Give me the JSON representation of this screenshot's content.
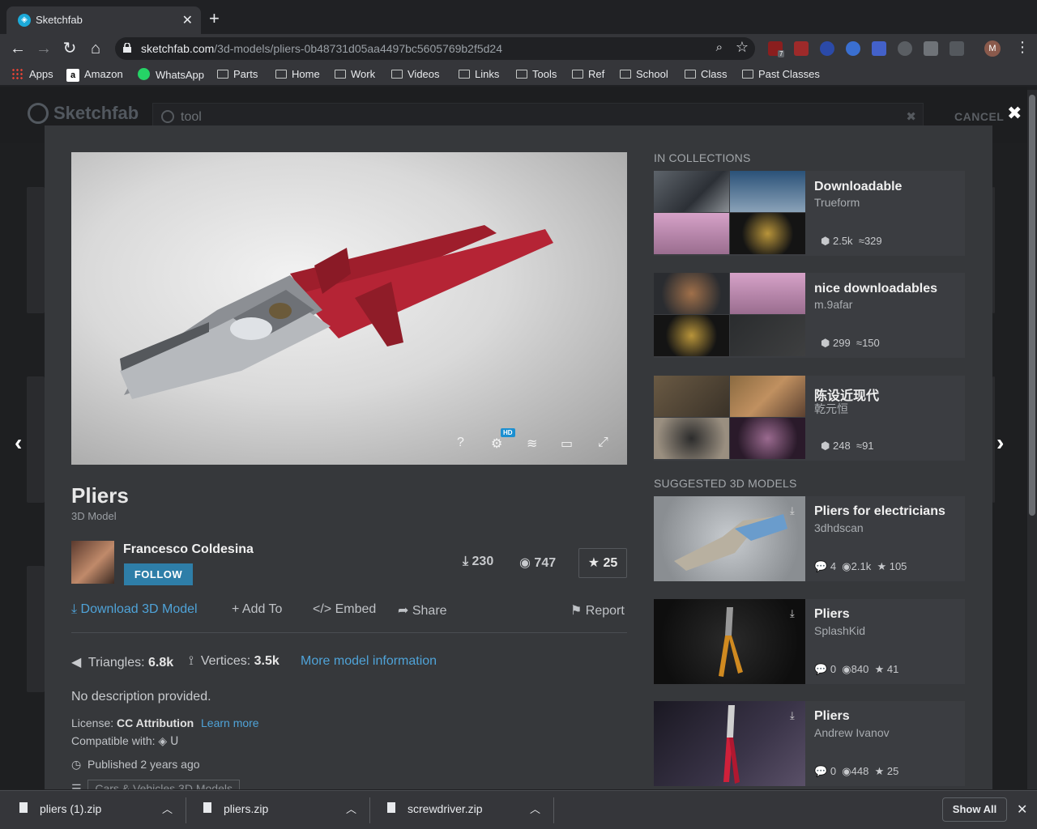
{
  "browser": {
    "tab_title": "Sketchfab",
    "url_host": "sketchfab.com",
    "url_path": "/3d-models/pliers-0b48731d05aa4497bc5605769b2f5d24",
    "extension_badge": "7",
    "profile_initial": "M",
    "bookmarks": [
      "Apps",
      "Amazon",
      "WhatsApp",
      "Parts",
      "Home",
      "Work",
      "Videos",
      "Links",
      "Tools",
      "Ref",
      "School",
      "Class",
      "Past Classes"
    ]
  },
  "site": {
    "logo": "Sketchfab",
    "search_value": "tool",
    "cancel_label": "CANCEL"
  },
  "model": {
    "title": "Pliers",
    "subtitle": "3D Model",
    "author": "Francesco Coldesina",
    "follow_label": "FOLLOW",
    "downloads": "230",
    "views": "747",
    "likes": "25",
    "viewer_hd_badge": "HD",
    "actions": {
      "download": "Download 3D Model",
      "add_to": "Add To",
      "embed": "Embed",
      "share": "Share",
      "report": "Report"
    },
    "triangles_label": "Triangles:",
    "triangles_value": "6.8k",
    "vertices_label": "Vertices:",
    "vertices_value": "3.5k",
    "more_info": "More model information",
    "description": "No description provided.",
    "license_label": "License:",
    "license_value": "CC Attribution",
    "learn_more": "Learn more",
    "compatible_label": "Compatible with:",
    "published": "Published 2 years ago",
    "category_tag": "Cars & Vehicles 3D Models"
  },
  "collections": {
    "heading": "IN COLLECTIONS",
    "items": [
      {
        "title": "Downloadable",
        "author": "Trueform",
        "models": "2.5k",
        "followers": "329"
      },
      {
        "title": "nice downloadables",
        "author": "m.9afar",
        "models": "299",
        "followers": "150"
      },
      {
        "title": "陈设近现代",
        "author": "乾元恒",
        "models": "248",
        "followers": "91"
      }
    ]
  },
  "suggested": {
    "heading": "SUGGESTED 3D MODELS",
    "items": [
      {
        "title": "Pliers for electricians",
        "author": "3dhdscan",
        "comments": "4",
        "views": "2.1k",
        "likes": "105"
      },
      {
        "title": "Pliers",
        "author": "SplashKid",
        "comments": "0",
        "views": "840",
        "likes": "41"
      },
      {
        "title": "Pliers",
        "author": "Andrew Ivanov",
        "comments": "0",
        "views": "448",
        "likes": "25"
      }
    ]
  },
  "downloads_bar": {
    "files": [
      "pliers (1).zip",
      "pliers.zip",
      "screwdriver.zip"
    ],
    "show_all": "Show All"
  },
  "colors": {
    "accent_blue": "#4fa3d8",
    "follow_button": "#2e7ea8",
    "modal_bg": "#36383b"
  }
}
